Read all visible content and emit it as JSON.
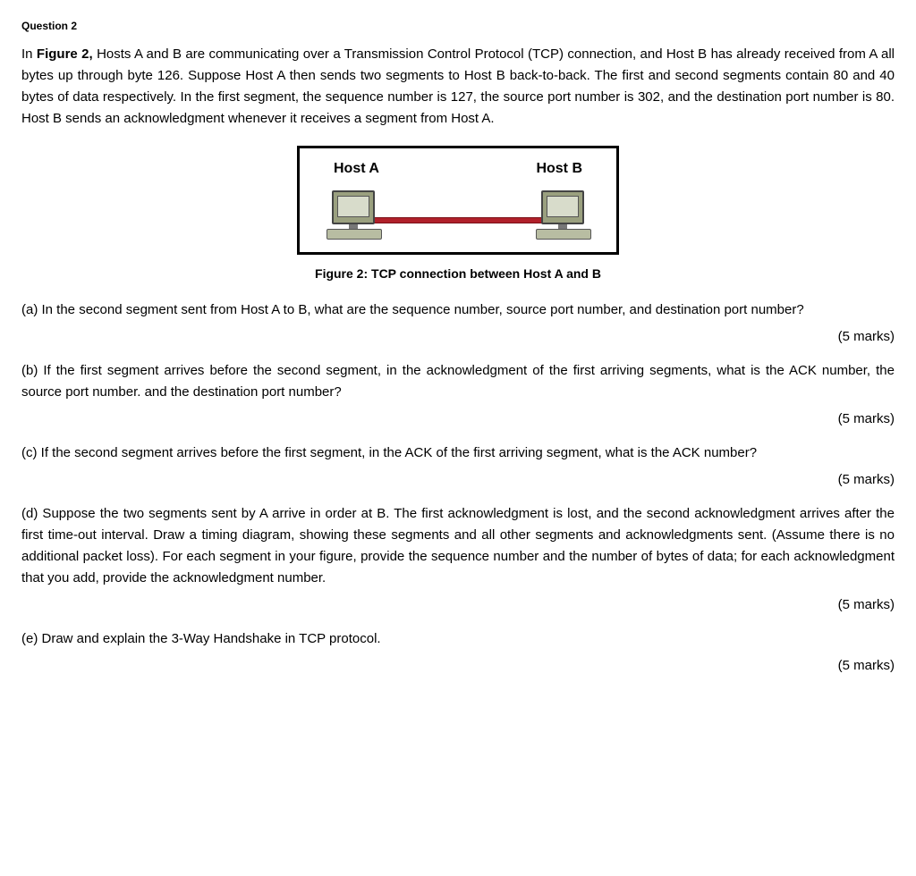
{
  "header": {
    "question_label": "Question 2"
  },
  "intro": {
    "prefix": "In ",
    "figure_ref": "Figure 2,",
    "rest": " Hosts A and B are communicating over a Transmission Control Protocol (TCP) connection, and Host B has already received from A all bytes up through byte 126. Suppose Host A then sends two segments to Host B back-to-back. The first and second segments contain 80 and 40 bytes of data respectively. In the first segment, the sequence number is 127, the source port number is 302, and the destination port number is 80. Host B sends an acknowledgment whenever it receives a segment from Host A."
  },
  "figure": {
    "host_a": "Host A",
    "host_b": "Host B",
    "caption": "Figure 2: TCP connection between Host A and B"
  },
  "parts": {
    "a": {
      "text": "(a) In the second segment sent from Host A to B, what are the sequence number, source port number, and destination port number?",
      "marks": "(5 marks)"
    },
    "b": {
      "text": "(b) If the first segment arrives before the second segment, in the acknowledgment of the first arriving segments, what is the ACK number, the source port number. and the destination port number?",
      "marks": "(5 marks)"
    },
    "c": {
      "text": "(c) If the second segment arrives before the first segment, in the ACK of the first arriving segment, what is the ACK number?",
      "marks": "(5 marks)"
    },
    "d": {
      "text": "(d) Suppose the two segments sent by A arrive in order at B. The first acknowledgment is lost, and the second acknowledgment arrives after the first time-out interval. Draw a timing diagram, showing these segments and all other segments and acknowledgments sent. (Assume there is no additional packet loss). For each segment in your figure, provide the sequence number and the number of bytes of data; for each acknowledgment that you add, provide the acknowledgment number.",
      "marks": "(5 marks)"
    },
    "e": {
      "text": "(e) Draw and explain the 3-Way Handshake in TCP protocol.",
      "marks": "(5 marks)"
    }
  }
}
